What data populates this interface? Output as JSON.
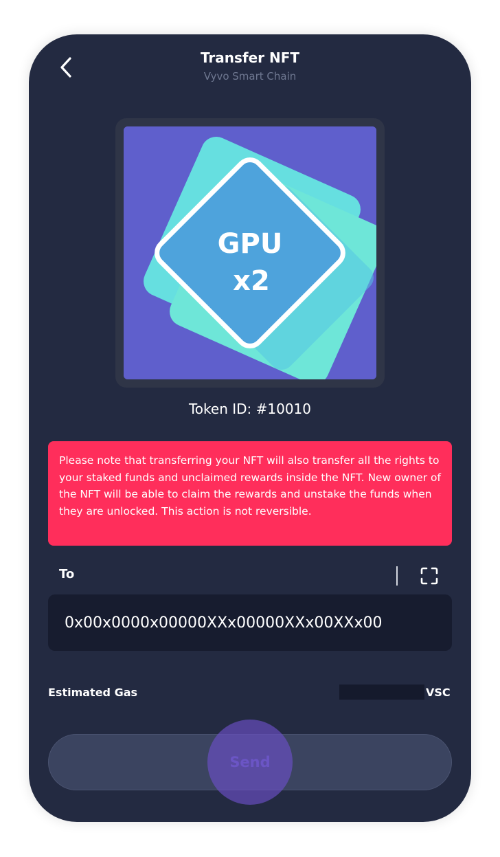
{
  "header": {
    "title": "Transfer NFT",
    "subtitle": "Vyvo Smart Chain",
    "back_icon": "chevron-left-icon"
  },
  "nft": {
    "image_text_line1": "GPU",
    "image_text_line2": "x2",
    "token_id_label": "Token ID: #10010",
    "colors": {
      "background": "#5f5fcc",
      "card_back": "#66dfe0",
      "card_front": "#6ee6d8",
      "diamond": "#4ea3dc"
    }
  },
  "warning": {
    "text": "Please note that transferring your NFT will also transfer all the rights to your staked funds and unclaimed rewards inside the NFT. New owner of the NFT will be able to claim the rewards and unstake the funds when they are unlocked. This action is not reversible."
  },
  "recipient": {
    "label": "To",
    "scan_icon": "scan-qr-icon",
    "address_value": "0x00x0000x00000XXx00000XXx00XXx00"
  },
  "gas": {
    "label": "Estimated Gas",
    "unit": "VSC"
  },
  "send_button": {
    "label": "Send"
  },
  "colors": {
    "screen_bg": "#232a41",
    "warning_bg": "#ff2e5b",
    "input_bg": "#171c2f",
    "button_bg": "#3b4460",
    "touch_indicator": "#6c50c8"
  }
}
